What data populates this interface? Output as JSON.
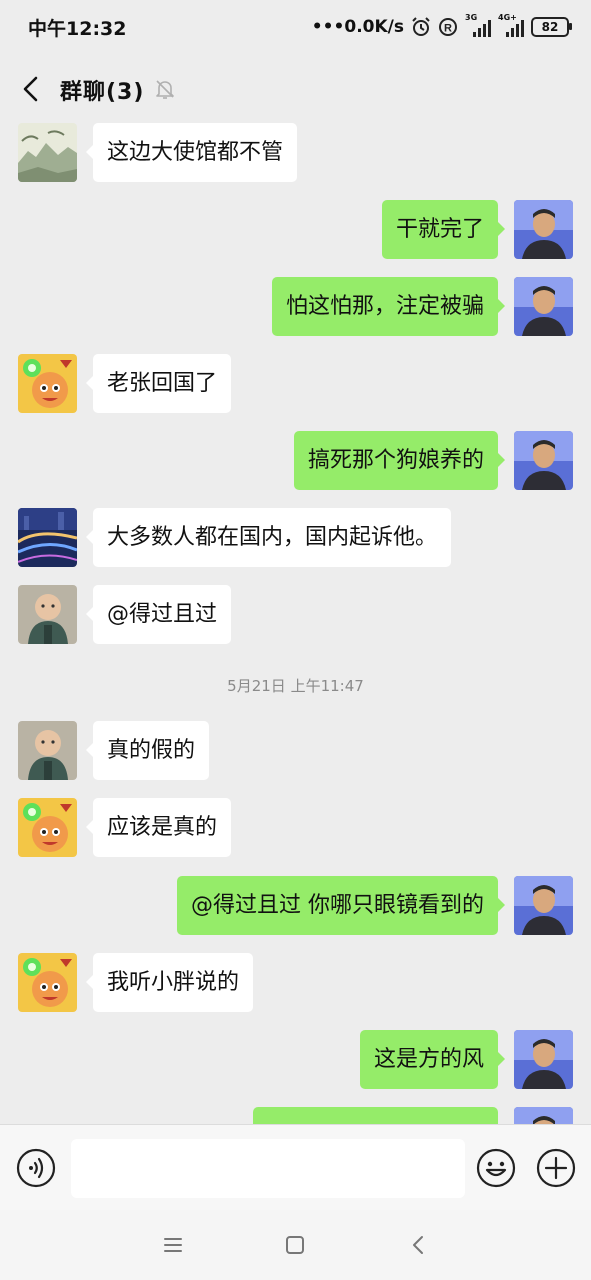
{
  "status": {
    "time": "中午12:32",
    "network_speed": "•••0.0K/s",
    "signal1_tag": "3G",
    "signal2_tag": "4G+",
    "battery": "82"
  },
  "header": {
    "title": "群聊(3)"
  },
  "messages": [
    {
      "side": "in",
      "avatar": "landscape-painting",
      "text": "这边大使馆都不管"
    },
    {
      "side": "out",
      "avatar": "self-photo",
      "text": "干就完了"
    },
    {
      "side": "out",
      "avatar": "self-photo",
      "text": "怕这怕那，注定被骗"
    },
    {
      "side": "in",
      "avatar": "cartoon-character",
      "text": "老张回国了"
    },
    {
      "side": "out",
      "avatar": "self-photo",
      "text": "搞死那个狗娘养的"
    },
    {
      "side": "in",
      "avatar": "night-city",
      "text": "大多数人都在国内，国内起诉他。"
    },
    {
      "side": "in",
      "avatar": "child-photo",
      "text": "@得过且过"
    },
    {
      "side": "in",
      "avatar": "child-photo",
      "text": "真的假的"
    },
    {
      "side": "in",
      "avatar": "cartoon-character",
      "text": "应该是真的"
    },
    {
      "side": "out",
      "avatar": "self-photo",
      "text": "@得过且过  你哪只眼镜看到的"
    },
    {
      "side": "in",
      "avatar": "cartoon-character",
      "text": "我听小胖说的"
    },
    {
      "side": "out",
      "avatar": "self-photo",
      "text": "这是方的风"
    },
    {
      "side": "out",
      "avatar": "self-photo",
      "text": ""
    }
  ],
  "timestamp": "5月21日 上午11:47",
  "colors": {
    "background": "#ededed",
    "bubble_out": "#95ec69",
    "bubble_in": "#ffffff"
  }
}
